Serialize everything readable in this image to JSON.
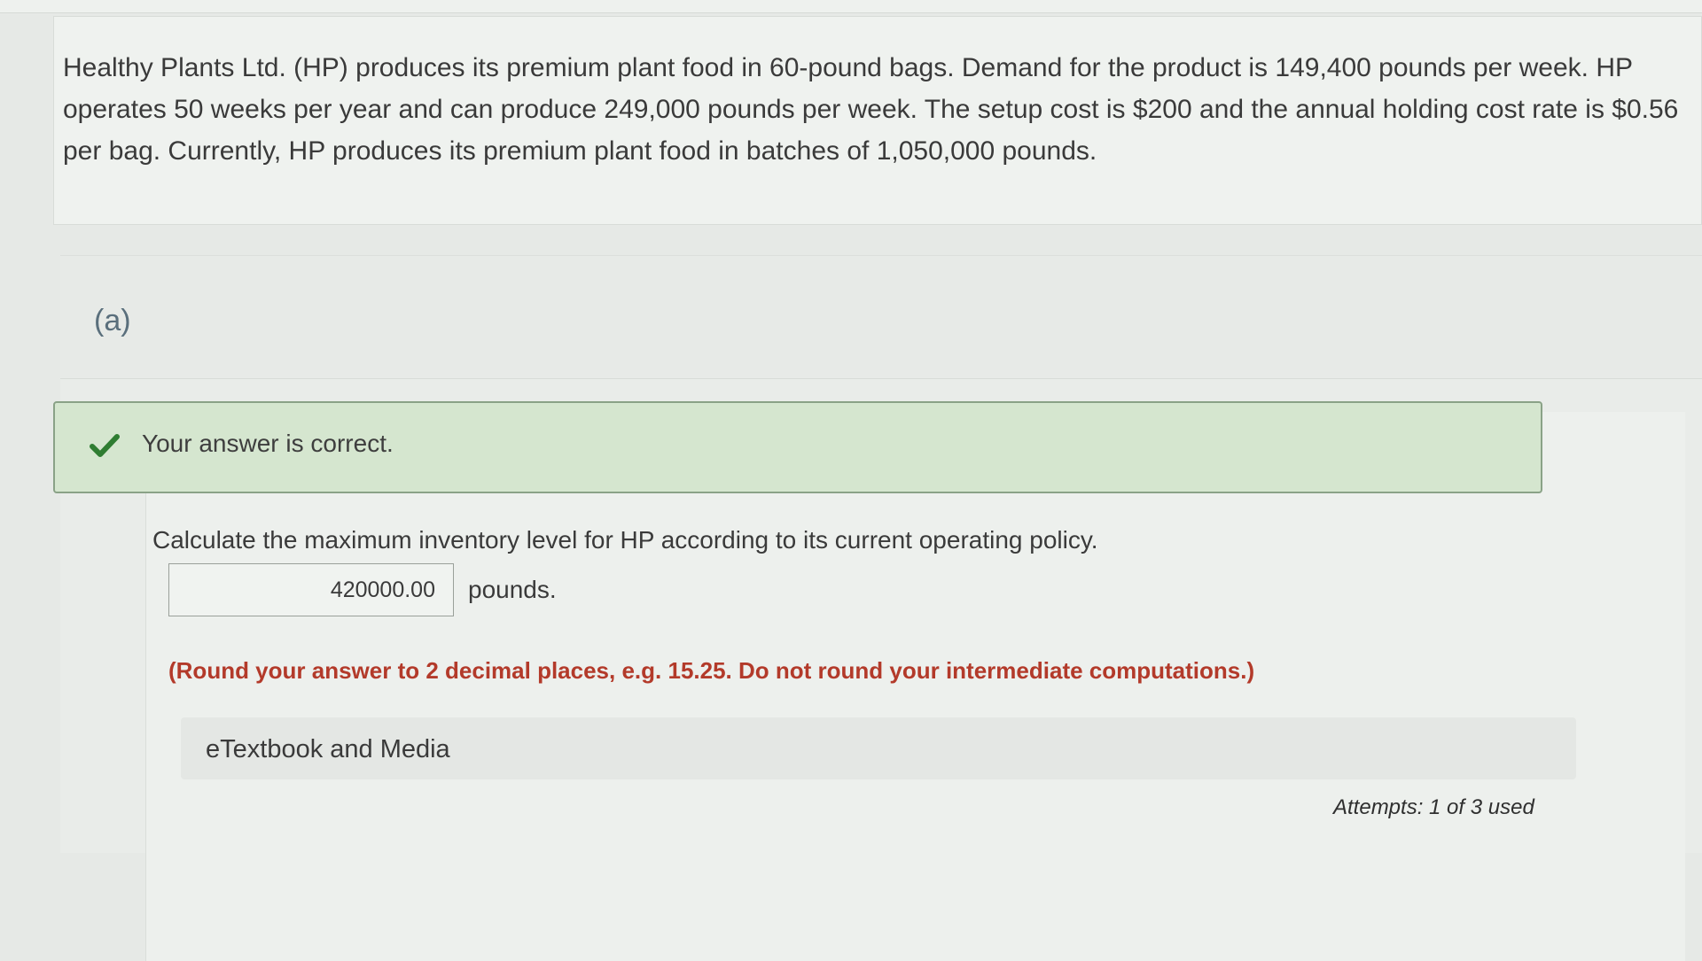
{
  "question": {
    "text": "Healthy Plants Ltd. (HP) produces its premium plant food in 60-pound bags. Demand for the product is 149,400 pounds per week. HP operates 50 weeks per year and can produce 249,000 pounds per week. The setup cost is $200 and the annual holding cost rate is $0.56 per bag. Currently, HP produces its premium plant food in batches of 1,050,000 pounds."
  },
  "part": {
    "label": "(a)"
  },
  "feedback": {
    "icon": "check-icon",
    "message": "Your answer is correct.",
    "color": "#2f7d32"
  },
  "prompt": {
    "text": "Calculate the maximum inventory level for HP according to its current operating policy."
  },
  "answer": {
    "value": "420000.00",
    "unit": "pounds."
  },
  "note": {
    "text": "(Round your answer to 2 decimal places, e.g. 15.25. Do not round your intermediate computations.)"
  },
  "resources": {
    "label": "eTextbook and Media"
  },
  "attempts": {
    "text": "Attempts: 1 of 3 used"
  }
}
